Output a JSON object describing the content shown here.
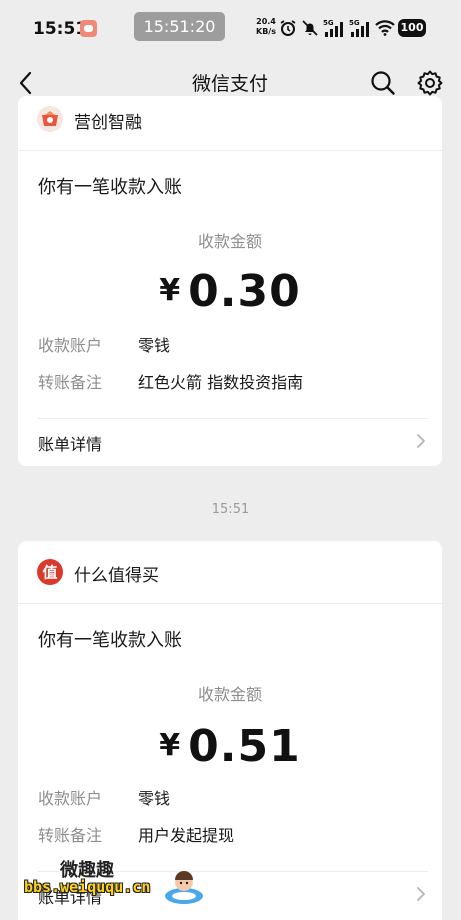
{
  "status_bar": {
    "time": "15:51",
    "pill_time": "15:51:20",
    "net_speed_value": "20.4",
    "net_speed_unit": "KB/s",
    "sim1": "5G",
    "sim2": "5G",
    "battery": "100"
  },
  "nav": {
    "title": "微信支付"
  },
  "messages": [
    {
      "merchant": "营创智融",
      "title": "你有一笔收款入账",
      "amount_label": "收款金额",
      "currency": "¥",
      "amount": "0.30",
      "account_key": "收款账户",
      "account_value": "零钱",
      "memo_key": "转账备注",
      "memo_value": "红色火箭 指数投资指南",
      "bill_label": "账单详情"
    },
    {
      "merchant": "什么值得买",
      "logo_char": "值",
      "title": "你有一笔收款入账",
      "amount_label": "收款金额",
      "currency": "¥",
      "amount": "0.51",
      "account_key": "收款账户",
      "account_value": "零钱",
      "memo_key": "转账备注",
      "memo_value": "用户发起提现",
      "bill_label": "账单详情"
    }
  ],
  "timestamp": "15:51",
  "watermark": {
    "title": "微趣趣",
    "url": "bbs.weiququ.cn"
  },
  "colors": {
    "background": "#ededed",
    "card": "#ffffff",
    "muted_text": "#8e8e8e",
    "merchant1_logo": "#e8563f",
    "merchant2_logo": "#d93a2b"
  }
}
